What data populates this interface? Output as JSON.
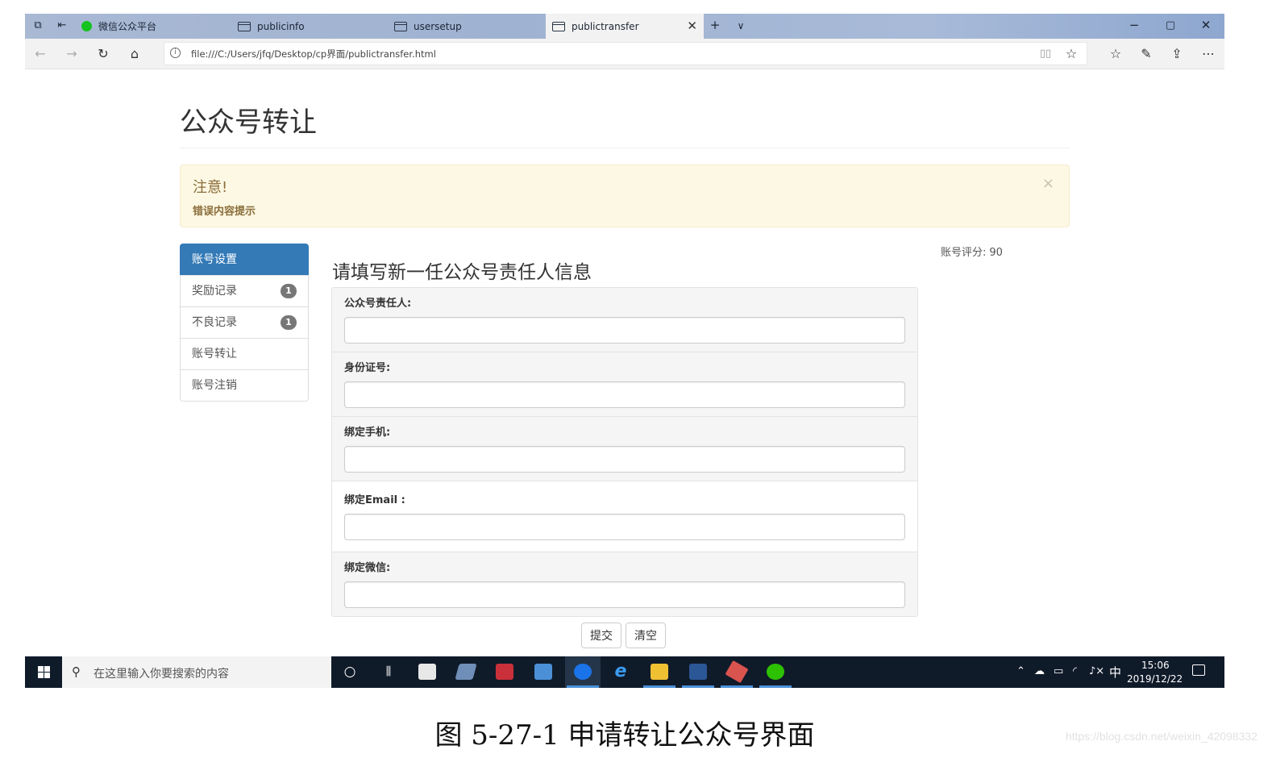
{
  "browser": {
    "tabs": [
      {
        "label": "微信公众平台",
        "active": false
      },
      {
        "label": "publicinfo",
        "active": false
      },
      {
        "label": "usersetup",
        "active": false
      },
      {
        "label": "publictransfer",
        "active": true
      }
    ],
    "url": "file:///C:/Users/jfq/Desktop/cp界面/publictransfer.html"
  },
  "page": {
    "title": "公众号转让",
    "alert": {
      "title": "注意!",
      "message": "错误内容提示",
      "close": "×"
    },
    "sidebar": {
      "items": [
        {
          "label": "账号设置",
          "badge": null,
          "active": true
        },
        {
          "label": "奖励记录",
          "badge": "1",
          "active": false
        },
        {
          "label": "不良记录",
          "badge": "1",
          "active": false
        },
        {
          "label": "账号转让",
          "badge": null,
          "active": false
        },
        {
          "label": "账号注销",
          "badge": null,
          "active": false
        }
      ]
    },
    "score": {
      "label": "账号评分:",
      "value": "90"
    },
    "form": {
      "heading": "请填写新一任公众号责任人信息",
      "fields": [
        {
          "label": "公众号责任人:",
          "value": ""
        },
        {
          "label": "身份证号:",
          "value": ""
        },
        {
          "label": "绑定手机:",
          "value": ""
        },
        {
          "label": "绑定Email :",
          "value": ""
        },
        {
          "label": "绑定微信:",
          "value": ""
        }
      ],
      "submit_label": "提交",
      "clear_label": "清空"
    }
  },
  "taskbar": {
    "search_placeholder": "在这里输入你要搜索的内容",
    "ime": "中",
    "time": "15:06",
    "date": "2019/12/22"
  },
  "caption": "图 5-27-1 申请转让公众号界面",
  "watermark": "https://blog.csdn.net/weixin_42098332",
  "colors": {
    "primary": "#337ab7",
    "alert_bg": "#fcf8e3",
    "alert_text": "#8a6d3b",
    "taskbar": "#101b2a",
    "badge": "#777777"
  }
}
